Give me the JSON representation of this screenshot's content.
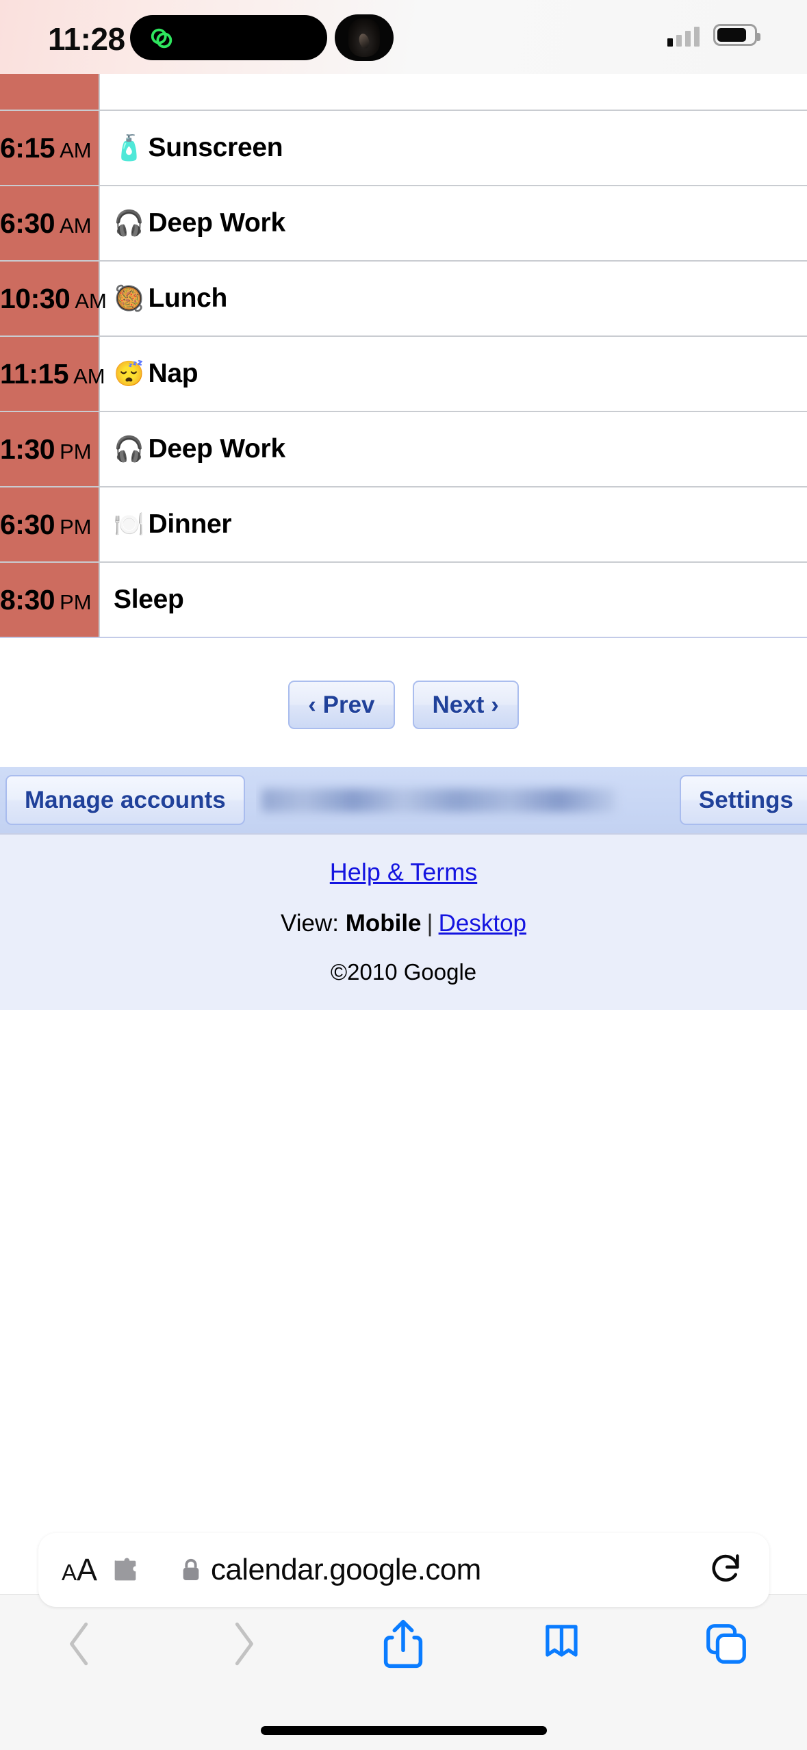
{
  "status_bar": {
    "time": "11:28",
    "icons": {
      "dynamic_island": "link-icon",
      "camera": "camera-cutout",
      "signal": "cellular-signal-icon",
      "battery": "battery-icon"
    }
  },
  "schedule": {
    "rows": [
      {
        "time": "6:15",
        "period": "AM",
        "emoji": "🧴",
        "emoji_name": "lotion-bottle-icon",
        "title": "Sunscreen"
      },
      {
        "time": "6:30",
        "period": "AM",
        "emoji": "🎧",
        "emoji_name": "headphone-icon",
        "title": "Deep Work"
      },
      {
        "time": "10:30",
        "period": "AM",
        "emoji": "🥘",
        "emoji_name": "shallow-pan-food-icon",
        "title": "Lunch"
      },
      {
        "time": "11:15",
        "period": "AM",
        "emoji": "😴",
        "emoji_name": "sleeping-face-icon",
        "title": "Nap"
      },
      {
        "time": "1:30",
        "period": "PM",
        "emoji": "🎧",
        "emoji_name": "headphone-icon",
        "title": "Deep Work"
      },
      {
        "time": "6:30",
        "period": "PM",
        "emoji": "🍽️",
        "emoji_name": "fork-knife-plate-icon",
        "title": "Dinner"
      },
      {
        "time": "8:30",
        "period": "PM",
        "emoji": "",
        "emoji_name": "",
        "title": "Sleep"
      }
    ],
    "time_column_color": "#cd6c5f",
    "row_border_color": "#c9ccd1"
  },
  "pagination": {
    "prev_label": "‹ Prev",
    "next_label": "Next ›"
  },
  "account_bar": {
    "manage_accounts_label": "Manage accounts",
    "settings_label": "Settings",
    "email_redacted": "████████████████",
    "background_color": "#c9d7f4"
  },
  "footer": {
    "help_terms": "Help & Terms",
    "view_prefix": "View:",
    "view_current": "Mobile",
    "view_separator": "|",
    "view_alternate": "Desktop",
    "copyright": "©2010 Google",
    "link_color": "#1414e0",
    "background_color": "#eaeefa"
  },
  "browser": {
    "address_bar": {
      "text_size_label_small": "A",
      "text_size_label_large": "A",
      "url": "calendar.google.com",
      "lock_icon": "lock-icon",
      "extensions_icon": "puzzle-piece-icon",
      "reload_icon": "reload-icon"
    },
    "toolbar": {
      "back_icon": "chevron-left-icon",
      "forward_icon": "chevron-right-icon",
      "share_icon": "share-icon",
      "bookmarks_icon": "book-icon",
      "tabs_icon": "tabs-icon",
      "accent_color": "#0a7cff",
      "disabled_color": "#c2c2c2"
    }
  }
}
